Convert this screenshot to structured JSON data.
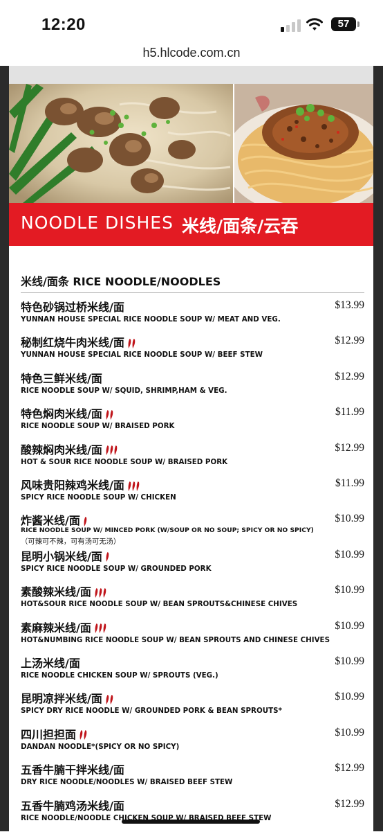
{
  "status_bar": {
    "time": "12:20",
    "battery": "57"
  },
  "browser": {
    "url": "h5.hlcode.com.cn"
  },
  "banner": {
    "title_en": "NOODLE DISHES",
    "title_cn": "米线/面条/云吞"
  },
  "section": {
    "title": "米线/面条 RICE NOODLE/NOODLES"
  },
  "menu_items": [
    {
      "name": "特色砂锅过桥米线/面",
      "desc": "YUNNAN HOUSE SPECIAL RICE NOODLE SOUP W/ MEAT AND VEG.",
      "price": "$13.99",
      "spice": 0
    },
    {
      "name": "秘制红烧牛肉米线/面",
      "desc": "YUNNAN HOUSE SPECIAL RICE NOODLE SOUP W/ BEEF STEW",
      "price": "$12.99",
      "spice": 2
    },
    {
      "name": "特色三鲜米线/面",
      "desc": "RICE NOODLE SOUP W/ SQUID, SHRIMP,HAM & VEG.",
      "price": "$12.99",
      "spice": 0
    },
    {
      "name": "特色焖肉米线/面",
      "desc": "RICE NOODLE SOUP W/ BRAISED PORK",
      "price": "$11.99",
      "spice": 2
    },
    {
      "name": "酸辣焖肉米线/面",
      "desc": "HOT & SOUR RICE NOODLE SOUP W/ BRAISED PORK",
      "price": "$12.99",
      "spice": 3
    },
    {
      "name": "风味贵阳辣鸡米线/面",
      "desc": "SPICY RICE NOODLE SOUP W/ CHICKEN",
      "price": "$11.99",
      "spice": 3
    },
    {
      "name": "炸酱米线/面",
      "desc": "RICE NOODLE SOUP W/ MINCED PORK (W/SOUP OR NO SOUP; SPICY OR NO SPICY)",
      "note": "（可辣可不辣，可有汤可无汤）",
      "price": "$10.99",
      "spice": 1
    },
    {
      "name": "昆明小锅米线/面",
      "desc": "SPICY RICE NOODLE SOUP W/ GROUNDED PORK",
      "price": "$10.99",
      "spice": 1
    },
    {
      "name": "素酸辣米线/面",
      "desc": "HOT&SOUR RICE NOODLE SOUP W/ BEAN SPROUTS&CHINESE CHIVES",
      "price": "$10.99",
      "spice": 3
    },
    {
      "name": "素麻辣米线/面",
      "desc": "HOT&NUMBING RICE NOODLE SOUP W/ BEAN SPROUTS AND CHINESE CHIVES",
      "price": "$10.99",
      "spice": 3
    },
    {
      "name": "上汤米线/面",
      "desc": "RICE NOODLE CHICKEN SOUP W/ SPROUTS (VEG.)",
      "price": "$10.99",
      "spice": 0
    },
    {
      "name": "昆明凉拌米线/面",
      "desc": "SPICY DRY RICE NOODLE W/ GROUNDED PORK & BEAN SPROUTS*",
      "price": "$10.99",
      "spice": 2
    },
    {
      "name": "四川担担面",
      "desc": "DANDAN NOODLE*(SPICY OR NO SPICY)",
      "price": "$10.99",
      "spice": 2
    },
    {
      "name": "五香牛腩干拌米线/面",
      "desc": "DRY RICE NOODLE/NOODLES W/ BRAISED BEEF STEW",
      "price": "$12.99",
      "spice": 0
    },
    {
      "name": "五香牛腩鸡汤米线/面",
      "desc": "RICE NOODLE/NOODLE CHICKEN SOUP W/ BRAISED BEEF STEW",
      "price": "$12.99",
      "spice": 0
    }
  ],
  "colors": {
    "banner_red": "#e31b23",
    "chili_red": "#c0141a",
    "frame_dark": "#2b2b2b"
  },
  "icons": {
    "signal": "cellular-signal-icon",
    "wifi": "wifi-icon",
    "battery": "battery-icon",
    "chili": "chili-pepper-icon"
  }
}
